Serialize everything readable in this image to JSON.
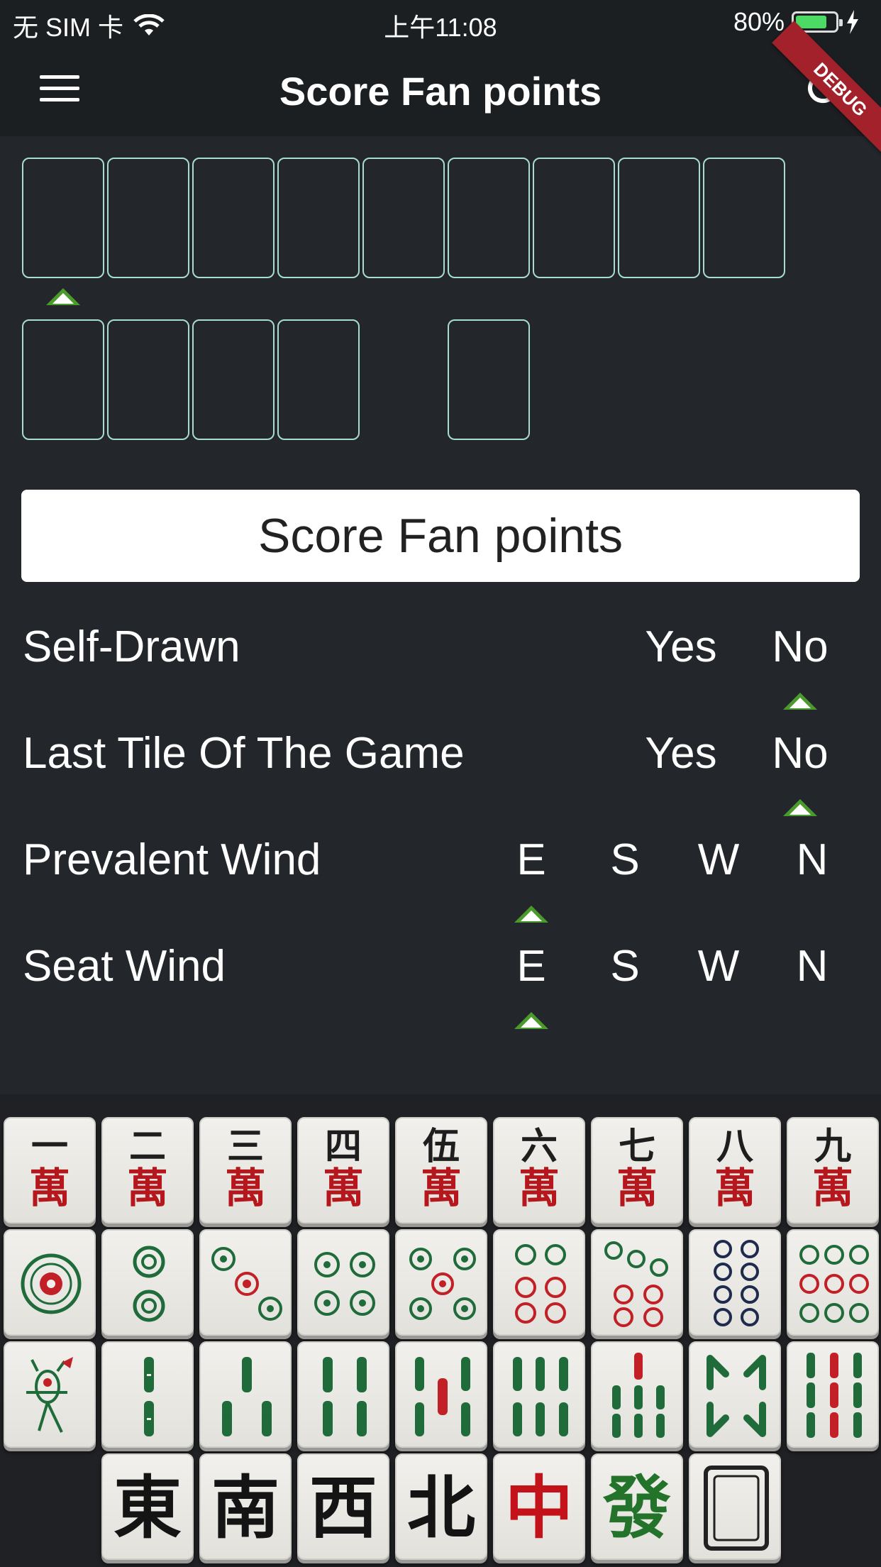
{
  "status_bar": {
    "carrier": "无 SIM 卡",
    "time": "上午11:08",
    "battery": "80%",
    "battery_level": 0.8
  },
  "app_bar": {
    "title": "Score Fan points",
    "menu_icon": "menu-icon",
    "refresh_icon": "refresh-icon",
    "debug_label": "DEBUG"
  },
  "score_button": {
    "label": "Score Fan points"
  },
  "options": [
    {
      "label": "Self-Drawn",
      "choices": [
        "Yes",
        "No"
      ],
      "selected": "No"
    },
    {
      "label": "Last Tile Of The Game",
      "choices": [
        "Yes",
        "No"
      ],
      "selected": "No"
    },
    {
      "label": "Prevalent Wind",
      "choices": [
        "E",
        "S",
        "W",
        "N"
      ],
      "selected": "E"
    },
    {
      "label": "Seat Wind",
      "choices": [
        "E",
        "S",
        "W",
        "N"
      ],
      "selected": "E"
    }
  ],
  "palette": {
    "characters": [
      {
        "num": "一",
        "suit": "萬"
      },
      {
        "num": "二",
        "suit": "萬"
      },
      {
        "num": "三",
        "suit": "萬"
      },
      {
        "num": "四",
        "suit": "萬"
      },
      {
        "num": "伍",
        "suit": "萬"
      },
      {
        "num": "六",
        "suit": "萬"
      },
      {
        "num": "七",
        "suit": "萬"
      },
      {
        "num": "八",
        "suit": "萬"
      },
      {
        "num": "九",
        "suit": "萬"
      }
    ],
    "dots_icons": [
      "circle-1-icon",
      "circle-2-icon",
      "circle-3-icon",
      "circle-4-icon",
      "circle-5-icon",
      "circle-6-icon",
      "circle-7-icon",
      "circle-8-icon",
      "circle-9-icon"
    ],
    "bamboo_icons": [
      "bamboo-1-icon",
      "bamboo-2-icon",
      "bamboo-3-icon",
      "bamboo-4-icon",
      "bamboo-5-icon",
      "bamboo-6-icon",
      "bamboo-7-icon",
      "bamboo-8-icon",
      "bamboo-9-icon"
    ],
    "honors": [
      "東",
      "南",
      "西",
      "北",
      "中",
      "發"
    ],
    "white_dragon_icon": "white-dragon-icon"
  },
  "colors": {
    "background": "#23272c",
    "app_bar": "#1c1f22",
    "slot_border": "#a6ddcf",
    "marker": "#4a9a2c",
    "character_red": "#b5171c",
    "dot_green": "#1f6b3a",
    "dot_red": "#c21f26",
    "dot_navy": "#1f2b4d",
    "debug_ribbon": "#a2212a"
  }
}
